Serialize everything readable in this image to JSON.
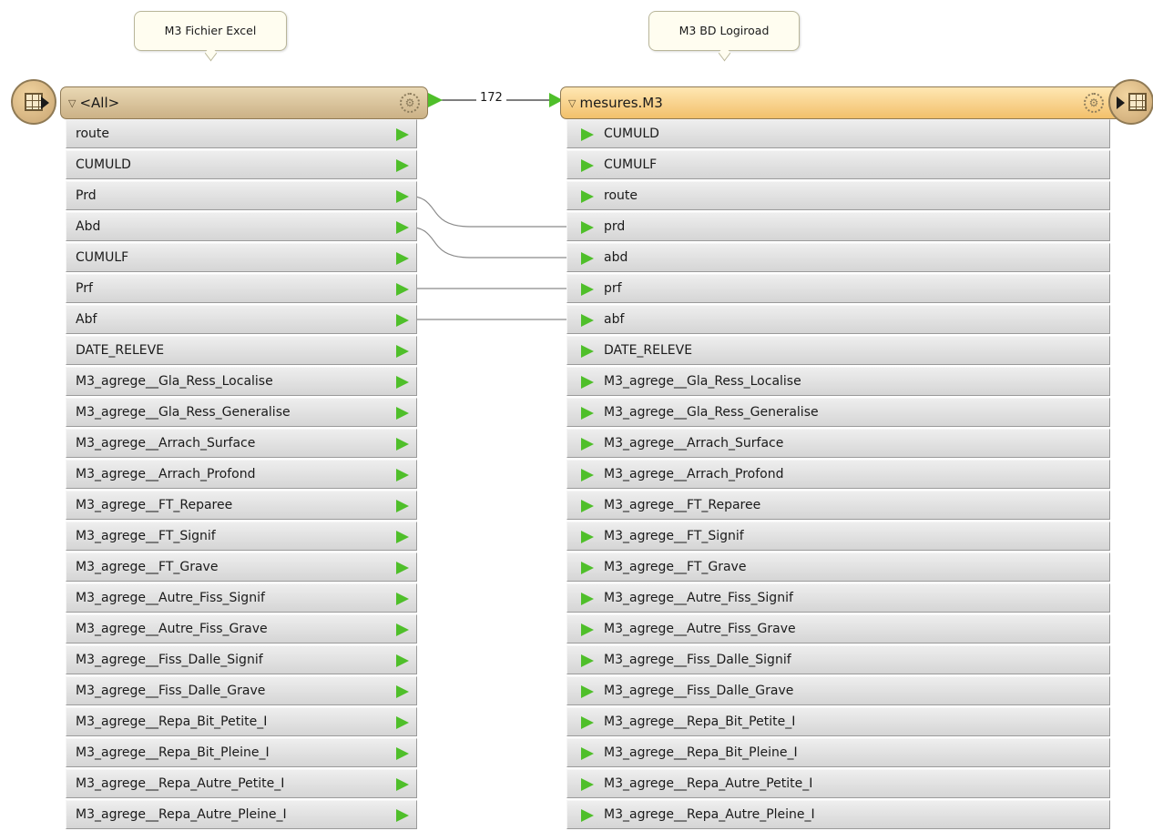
{
  "annotations": {
    "reader": "M3 Fichier Excel",
    "writer": "M3 BD Logiroad"
  },
  "reader": {
    "title": "<All>",
    "attributes": [
      "route",
      "CUMULD",
      "Prd",
      "Abd",
      "CUMULF",
      "Prf",
      "Abf",
      "DATE_RELEVE",
      "M3_agrege__Gla_Ress_Localise",
      "M3_agrege__Gla_Ress_Generalise",
      "M3_agrege__Arrach_Surface",
      "M3_agrege__Arrach_Profond",
      "M3_agrege__FT_Reparee",
      "M3_agrege__FT_Signif",
      "M3_agrege__FT_Grave",
      "M3_agrege__Autre_Fiss_Signif",
      "M3_agrege__Autre_Fiss_Grave",
      "M3_agrege__Fiss_Dalle_Signif",
      "M3_agrege__Fiss_Dalle_Grave",
      "M3_agrege__Repa_Bit_Petite_I",
      "M3_agrege__Repa_Bit_Pleine_I",
      "M3_agrege__Repa_Autre_Petite_I",
      "M3_agrege__Repa_Autre_Pleine_I"
    ]
  },
  "writer": {
    "title": "mesures.M3",
    "attributes": [
      "CUMULD",
      "CUMULF",
      "route",
      "prd",
      "abd",
      "prf",
      "abf",
      "DATE_RELEVE",
      "M3_agrege__Gla_Ress_Localise",
      "M3_agrege__Gla_Ress_Generalise",
      "M3_agrege__Arrach_Surface",
      "M3_agrege__Arrach_Profond",
      "M3_agrege__FT_Reparee",
      "M3_agrege__FT_Signif",
      "M3_agrege__FT_Grave",
      "M3_agrege__Autre_Fiss_Signif",
      "M3_agrege__Autre_Fiss_Grave",
      "M3_agrege__Fiss_Dalle_Signif",
      "M3_agrege__Fiss_Dalle_Grave",
      "M3_agrege__Repa_Bit_Petite_I",
      "M3_agrege__Repa_Bit_Pleine_I",
      "M3_agrege__Repa_Autre_Petite_I",
      "M3_agrege__Repa_Autre_Pleine_I"
    ]
  },
  "connection": {
    "feature_count": "172"
  },
  "attribute_links": [
    {
      "from": "Prd",
      "to": "prd"
    },
    {
      "from": "Abd",
      "to": "abd"
    },
    {
      "from": "Prf",
      "to": "prf"
    },
    {
      "from": "Abf",
      "to": "abf"
    }
  ],
  "colors": {
    "port_flag": "#4fbf2a",
    "reader_header": "#cbb186",
    "writer_header": "#f2c06b"
  }
}
